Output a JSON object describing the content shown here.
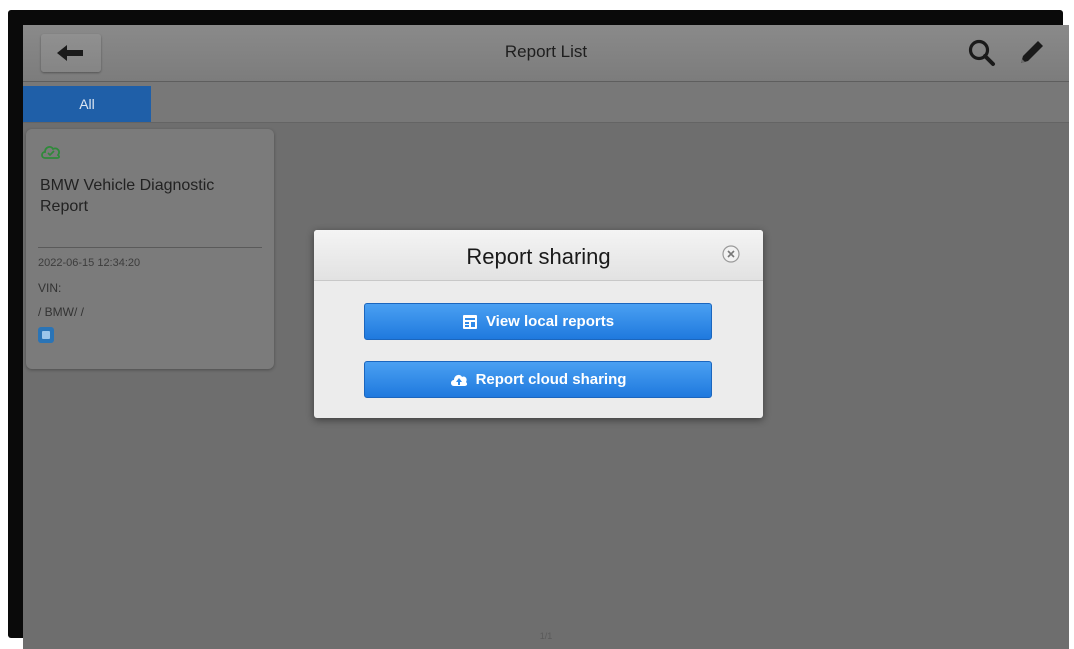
{
  "header": {
    "title": "Report List"
  },
  "tabs": [
    {
      "label": "All",
      "active": true
    }
  ],
  "report_card": {
    "title": "BMW Vehicle Diagnostic Report",
    "date": "2022-06-15 12:34:20",
    "vin_label": "VIN:",
    "make": "/ BMW/ /"
  },
  "dialog": {
    "title": "Report sharing",
    "buttons": {
      "view_local": "View local reports",
      "cloud_sharing": "Report cloud sharing"
    }
  },
  "footer": {
    "page_indicator": "1/1"
  },
  "colors": {
    "tab_active": "#1f5fa8",
    "button_blue": "#2f8ae8",
    "screen_overlay": "#6e6e6e"
  },
  "icons": [
    "back-arrow-icon",
    "search-icon",
    "edit-icon",
    "cloud-icon",
    "close-icon",
    "report-icon",
    "cloud-upload-icon"
  ]
}
